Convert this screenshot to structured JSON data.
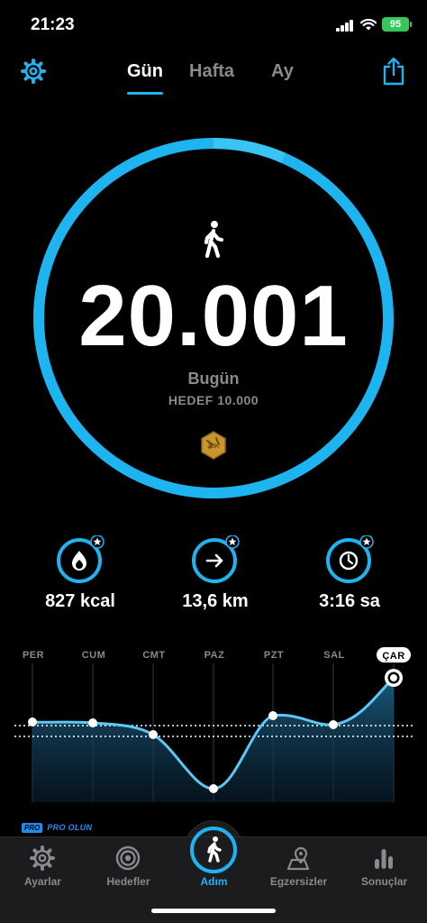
{
  "status_bar": {
    "time": "21:23",
    "battery": "95"
  },
  "tabs": [
    {
      "label": "Gün",
      "active": true
    },
    {
      "label": "Hafta",
      "active": false
    },
    {
      "label": "Ay",
      "active": false
    }
  ],
  "summary": {
    "steps": "20.001",
    "period": "Bugün",
    "goal": "HEDEF 10.000",
    "badge": "20K",
    "progress": 1.0
  },
  "stats": [
    {
      "icon": "flame-icon",
      "value": "827 kcal"
    },
    {
      "icon": "arrow-right-icon",
      "value": "13,6 km"
    },
    {
      "icon": "clock-icon",
      "value": "3:16 sa"
    }
  ],
  "week_chart": {
    "days": [
      "PER",
      "CUM",
      "CMT",
      "PAZ",
      "PZT",
      "SAL",
      "ÇAR"
    ],
    "selected": "ÇAR"
  },
  "pro": {
    "tag": "PRO",
    "text": "PRO OLUN"
  },
  "tabbar": [
    {
      "label": "Ayarlar",
      "icon": "gear-icon",
      "active": false
    },
    {
      "label": "Hedefler",
      "icon": "target-icon",
      "active": false
    },
    {
      "label": "Adım",
      "icon": "walker-icon",
      "active": true
    },
    {
      "label": "Egzersizler",
      "icon": "map-pin-icon",
      "active": false
    },
    {
      "label": "Sonuçlar",
      "icon": "bar-chart-icon",
      "active": false
    }
  ],
  "colors": {
    "accent": "#1eb4f0",
    "background": "#000000",
    "muted": "#8a8a8e"
  }
}
